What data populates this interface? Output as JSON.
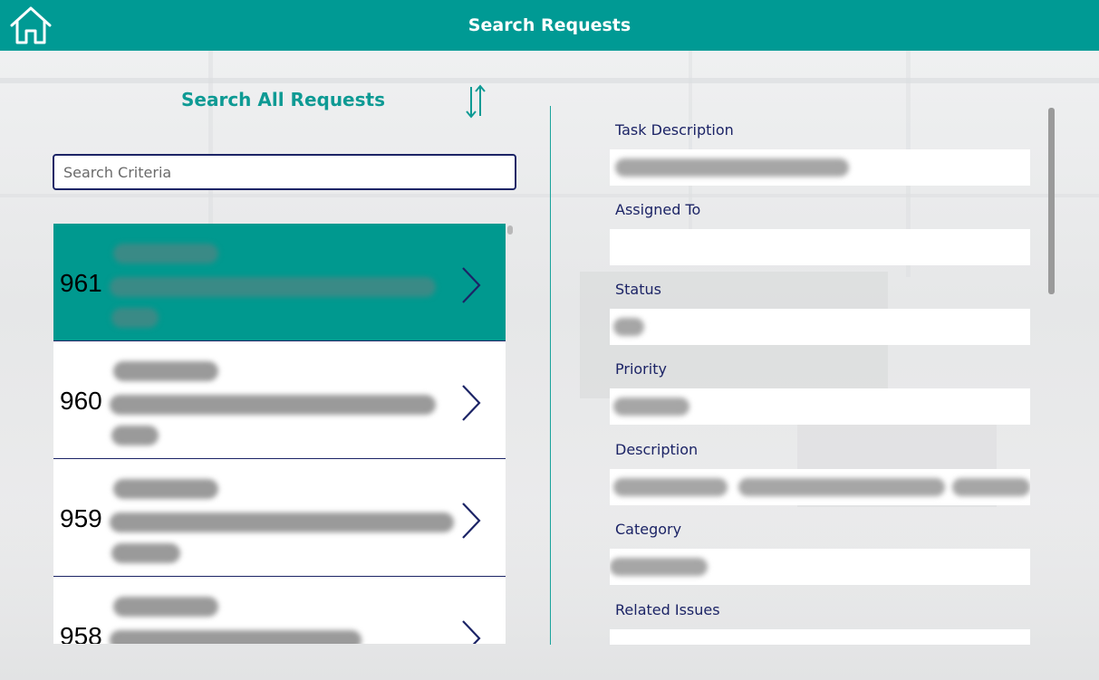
{
  "header": {
    "title": "Search Requests",
    "home_icon": "home-icon"
  },
  "left_panel": {
    "title": "Search All Requests",
    "sort_icon": "sort-arrows-icon",
    "search": {
      "placeholder": "Search Criteria",
      "value": ""
    }
  },
  "requests": [
    {
      "id": "961",
      "selected": true
    },
    {
      "id": "960",
      "selected": false
    },
    {
      "id": "959",
      "selected": false
    },
    {
      "id": "958",
      "selected": false
    }
  ],
  "details": {
    "fields": [
      {
        "label": "Task Description"
      },
      {
        "label": "Assigned To"
      },
      {
        "label": "Status"
      },
      {
        "label": "Priority"
      },
      {
        "label": "Description"
      },
      {
        "label": "Category"
      },
      {
        "label": "Related Issues"
      }
    ]
  },
  "colors": {
    "accent": "#009a94",
    "navy": "#1c2466",
    "label": "#1c2466"
  }
}
